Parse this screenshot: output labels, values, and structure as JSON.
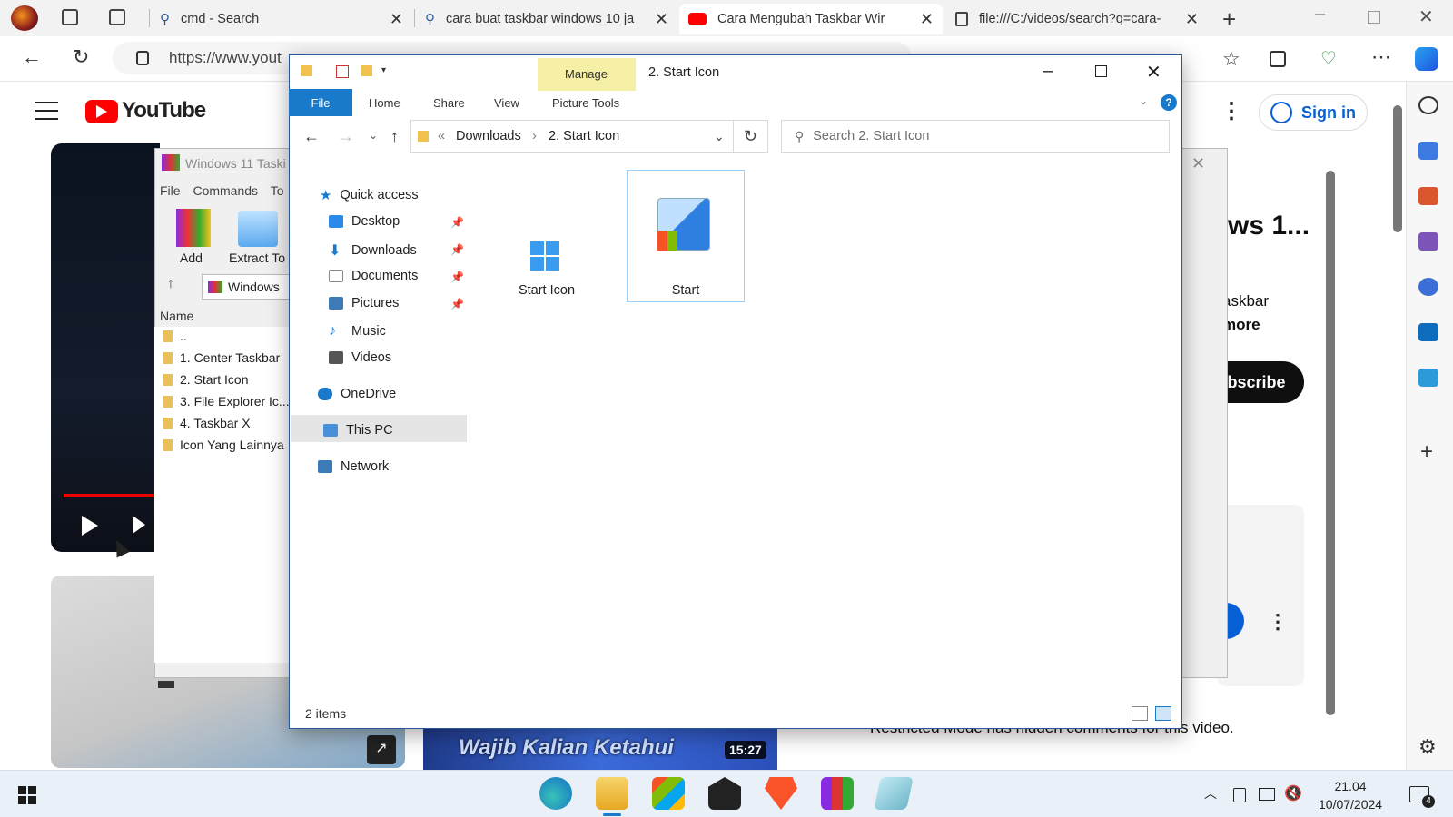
{
  "browser": {
    "tabs": [
      {
        "title": "cmd - Search",
        "icon": "search-icon"
      },
      {
        "title": "cara buat taskbar windows 10 ja",
        "icon": "search-icon"
      },
      {
        "title": "Cara Mengubah Taskbar Wir",
        "icon": "youtube-icon",
        "active": true
      },
      {
        "title": "file:///C:/videos/search?q=cara-",
        "icon": "file-icon"
      }
    ],
    "url": "https://www.yout"
  },
  "youtube": {
    "logo": "YouTube",
    "sign_in": "Sign in",
    "title_fragment": "ws 1...",
    "desc_line1": "askbar",
    "desc_line2": "more",
    "subscribe": "ubscribe",
    "restricted": "Restricted Mode has hidden comments for this video.",
    "thumb_text": "Wajib Kalian Ketahui",
    "duration": "15:27"
  },
  "winrar": {
    "title": "Windows 11 Taski",
    "menu": [
      "File",
      "Commands",
      "To"
    ],
    "add": "Add",
    "extract": "Extract To",
    "path": "Windows",
    "col_name": "Name",
    "rows": [
      "..",
      "1. Center Taskbar",
      "2. Start Icon",
      "3. File Explorer Ic...",
      "4. Taskbar X",
      "Icon Yang Lainnya"
    ]
  },
  "explorer": {
    "title": "2. Start Icon",
    "manage": "Manage",
    "ribbon_tabs": [
      "File",
      "Home",
      "Share",
      "View",
      "Picture Tools"
    ],
    "breadcrumb": [
      "Downloads",
      "2. Start Icon"
    ],
    "search_placeholder": "Search 2. Start Icon",
    "nav": {
      "quick_access": "Quick access",
      "desktop": "Desktop",
      "downloads": "Downloads",
      "documents": "Documents",
      "pictures": "Pictures",
      "music": "Music",
      "videos": "Videos",
      "onedrive": "OneDrive",
      "this_pc": "This PC",
      "network": "Network"
    },
    "files": [
      "Start Icon",
      "Start"
    ],
    "status": "2 items"
  },
  "taskbar": {
    "time": "21.04",
    "date": "10/07/2024",
    "notifications": "4"
  },
  "colors": {
    "accent": "#1979ca",
    "youtube_red": "#ff0000",
    "manage_bg": "#f5f0a5"
  }
}
